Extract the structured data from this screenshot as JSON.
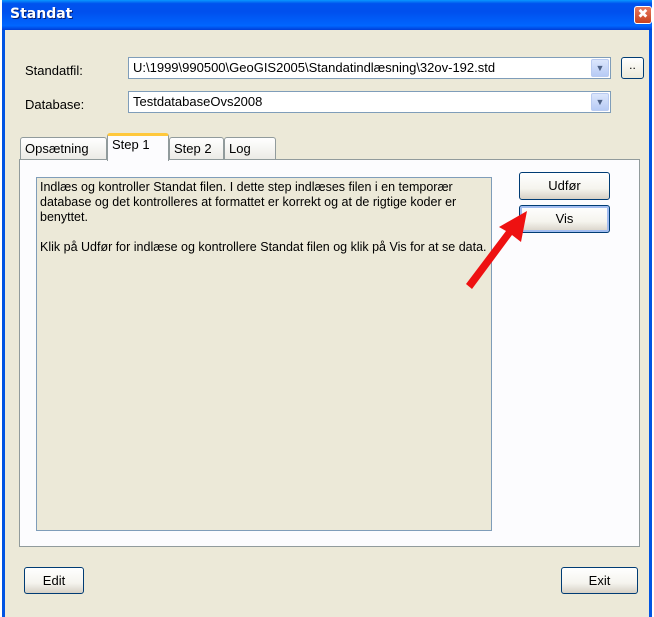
{
  "window": {
    "title": "Standat",
    "close_glyph": "✖"
  },
  "form": {
    "standatfil_label": "Standatfil:",
    "standatfil_value": "U:\\1999\\990500\\GeoGIS2005\\Standatindlæsning\\32ov-192.std",
    "browse_label": "..",
    "database_label": "Database:",
    "database_value": "TestdatabaseOvs2008"
  },
  "tabs": [
    {
      "label": "Opsætning"
    },
    {
      "label": "Step 1",
      "active": true
    },
    {
      "label": "Step 2"
    },
    {
      "label": "Log"
    }
  ],
  "step1": {
    "paragraph1": "Indlæs og kontroller Standat filen. I dette step indlæses filen i en temporær database og det kontrolleres at formattet er korrekt og at de rigtige koder er benyttet.",
    "paragraph2": "Klik på Udfør for indlæse og kontrollere Standat filen og klik på Vis for at se data.",
    "udfor_label": "Udfør",
    "vis_label": "Vis"
  },
  "footer": {
    "edit_label": "Edit",
    "exit_label": "Exit"
  },
  "colors": {
    "titlebar": "#0054e3",
    "dialog_bg": "#ece9d8",
    "tab_highlight": "#ffc83c",
    "annotation_arrow": "#ee1111"
  },
  "icons": {
    "close": "close-icon",
    "dropdown": "chevron-down-icon",
    "annotation": "red-arrow-annotation"
  }
}
